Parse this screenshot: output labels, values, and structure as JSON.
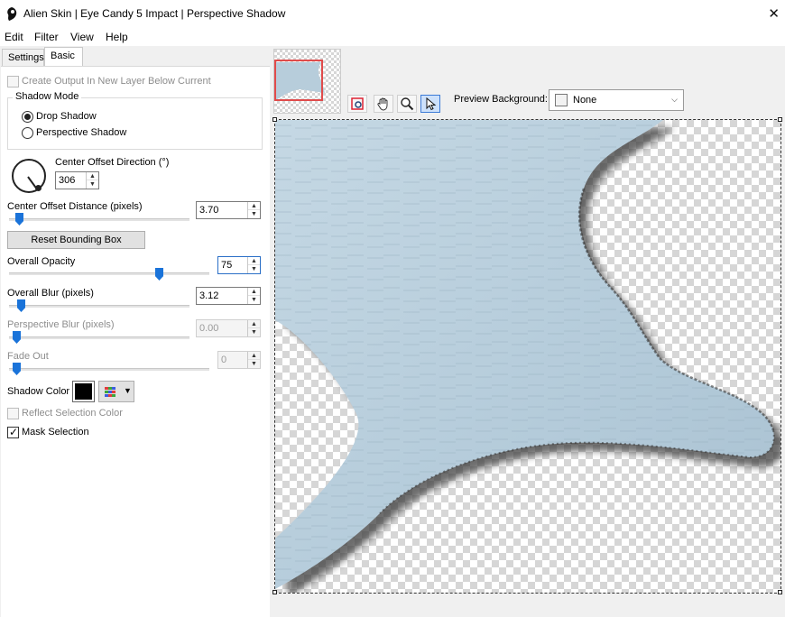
{
  "window": {
    "title": "Alien Skin | Eye Candy 5 Impact | Perspective Shadow"
  },
  "menu": [
    "Edit",
    "Filter",
    "View",
    "Help"
  ],
  "tabs": [
    {
      "label": "Settings",
      "active": false
    },
    {
      "label": "Basic",
      "active": true
    }
  ],
  "basic": {
    "create_output_label": "Create Output In New Layer Below Current",
    "create_output_checked": false,
    "shadow_mode": {
      "title": "Shadow Mode",
      "options": [
        {
          "label": "Drop Shadow",
          "selected": true
        },
        {
          "label": "Perspective Shadow",
          "selected": false
        }
      ]
    },
    "center_offset_direction": {
      "label": "Center Offset Direction (°)",
      "value": "306"
    },
    "center_offset_distance": {
      "label": "Center Offset Distance (pixels)",
      "value": "3.70",
      "level": 0.02
    },
    "reset_bounding_box": "Reset Bounding Box",
    "overall_opacity": {
      "label": "Overall Opacity",
      "value": "75",
      "level": 0.75
    },
    "overall_blur": {
      "label": "Overall Blur (pixels)",
      "value": "3.12",
      "level": 0.03
    },
    "perspective_blur": {
      "label": "Perspective Blur (pixels)",
      "value": "0.00",
      "level": 0.0
    },
    "fade_out": {
      "label": "Fade Out",
      "value": "0",
      "level": 0.0
    },
    "shadow_color": {
      "label": "Shadow Color",
      "color": "#000000"
    },
    "reflect_selection_color": {
      "label": "Reflect Selection Color",
      "checked": false
    },
    "mask_selection": {
      "label": "Mask Selection",
      "checked": true
    }
  },
  "preview": {
    "background_label": "Preview Background:",
    "background_value": "None",
    "tools": [
      "navigate-icon",
      "hand-icon",
      "zoom-icon",
      "pointer-icon"
    ],
    "shape_color": "#b9cfdd",
    "shadow_color": "#4a4a4a"
  }
}
